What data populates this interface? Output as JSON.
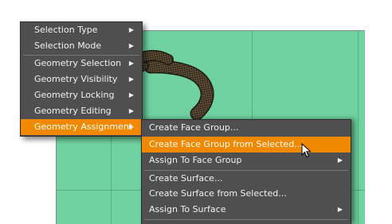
{
  "colors": {
    "viewport_bg": "#6fd2a0",
    "menu_bg": "#4f4f4f",
    "highlight": "#f08800",
    "menu_text": "#f2f2f2"
  },
  "viewport": {
    "content": "snake-model",
    "style": "wireframe-shaded"
  },
  "main_menu": {
    "items": [
      {
        "label": "Selection Type",
        "submenu": true
      },
      {
        "label": "Selection Mode",
        "submenu": true
      },
      {
        "label": "Geometry Selection",
        "submenu": true
      },
      {
        "label": "Geometry Visibility",
        "submenu": true
      },
      {
        "label": "Geometry Locking",
        "submenu": true
      },
      {
        "label": "Geometry Editing",
        "submenu": true
      },
      {
        "label": "Geometry Assignment",
        "submenu": true,
        "active": true
      }
    ]
  },
  "sub_menu": {
    "items": [
      {
        "label": "Create Face Group..."
      },
      {
        "label": "Create Face Group from Selected...",
        "active": true
      },
      {
        "label": "Assign To Face Group",
        "submenu": true
      },
      {
        "label": "Create Surface..."
      },
      {
        "label": "Create Surface from Selected..."
      },
      {
        "label": "Assign To Surface",
        "submenu": true
      }
    ]
  },
  "icons": {
    "submenu_arrow": "triangle-right-icon",
    "pointer": "mouse-pointer-icon"
  }
}
